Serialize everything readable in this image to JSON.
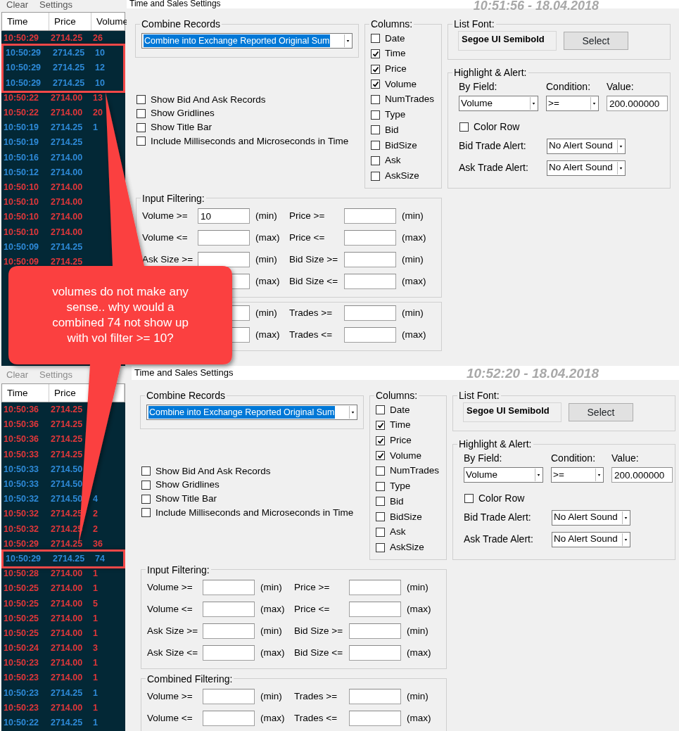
{
  "annotation": {
    "text": "volumes do not make any sense.. why would a combined 74 not show up with vol filter >= 10?"
  },
  "panels": [
    {
      "list": {
        "menu": [
          "Clear",
          "Settings"
        ],
        "columns": [
          "Time",
          "Price",
          "Volume"
        ],
        "rows": [
          {
            "time": "10:50:29",
            "price": "2714.25",
            "volume": "26",
            "color": "#e2373a",
            "boxed": false
          },
          {
            "time": "10:50:29",
            "price": "2714.25",
            "volume": "10",
            "color": "#2e8ad8",
            "boxed": true
          },
          {
            "time": "10:50:29",
            "price": "2714.25",
            "volume": "12",
            "color": "#2e8ad8",
            "boxed": true
          },
          {
            "time": "10:50:29",
            "price": "2714.25",
            "volume": "10",
            "color": "#2e8ad8",
            "boxed": true
          },
          {
            "time": "10:50:22",
            "price": "2714.00",
            "volume": "13",
            "color": "#e2373a",
            "boxed": false
          },
          {
            "time": "10:50:22",
            "price": "2714.00",
            "volume": "20",
            "color": "#e2373a",
            "boxed": false
          },
          {
            "time": "10:50:19",
            "price": "2714.25",
            "volume": "1",
            "color": "#2e8ad8",
            "boxed": false
          },
          {
            "time": "10:50:19",
            "price": "2714.25",
            "color": "#2e8ad8",
            "boxed": false
          },
          {
            "time": "10:50:16",
            "price": "2714.00",
            "color": "#2e8ad8",
            "boxed": false
          },
          {
            "time": "10:50:12",
            "price": "2714.00",
            "color": "#2e8ad8",
            "boxed": false
          },
          {
            "time": "10:50:10",
            "price": "2714.00",
            "color": "#e2373a",
            "boxed": false
          },
          {
            "time": "10:50:10",
            "price": "2714.00",
            "color": "#e2373a",
            "boxed": false
          },
          {
            "time": "10:50:10",
            "price": "2714.00",
            "color": "#e2373a",
            "boxed": false
          },
          {
            "time": "10:50:10",
            "price": "2714.00",
            "color": "#e2373a",
            "boxed": false
          },
          {
            "time": "10:50:09",
            "price": "2714.25",
            "color": "#2e8ad8",
            "boxed": false
          },
          {
            "time": "10:50:09",
            "price": "2714.25",
            "color": "#e2373a",
            "boxed": false
          }
        ]
      },
      "dialog": {
        "title": "Time and Sales Settings",
        "timestamp": "10:51:56 - 18.04.2018",
        "combine": {
          "legend": "Combine Records",
          "value": "Combine into Exchange Reported Original Sum"
        },
        "options": [
          {
            "label": "Show Bid And Ask Records",
            "checked": false
          },
          {
            "label": "Show Gridlines",
            "checked": false
          },
          {
            "label": "Show Title Bar",
            "checked": false
          },
          {
            "label": "Include Milliseconds and Microseconds in Time",
            "checked": false
          }
        ],
        "columns_group": {
          "legend": "Columns:",
          "items": [
            {
              "label": "Date",
              "checked": false
            },
            {
              "label": "Time",
              "checked": true
            },
            {
              "label": "Price",
              "checked": true
            },
            {
              "label": "Volume",
              "checked": true
            },
            {
              "label": "NumTrades",
              "checked": false
            },
            {
              "label": "Type",
              "checked": false
            },
            {
              "label": "Bid",
              "checked": false
            },
            {
              "label": "BidSize",
              "checked": false
            },
            {
              "label": "Ask",
              "checked": false
            },
            {
              "label": "AskSize",
              "checked": false
            }
          ]
        },
        "list_font": {
          "legend": "List Font:",
          "font": "Segoe UI Semibold",
          "button": "Select"
        },
        "highlight": {
          "legend": "Highlight & Alert:",
          "by_field_label": "By Field:",
          "condition_label": "Condition:",
          "value_label": "Value:",
          "by_field": "Volume",
          "condition": ">=",
          "value": "200.000000",
          "color_row": {
            "label": "Color Row",
            "checked": false
          },
          "alerts": [
            {
              "label": "Bid Trade Alert:",
              "value": "No Alert Sound"
            },
            {
              "label": "Ask Trade Alert:",
              "value": "No Alert Sound"
            }
          ]
        },
        "input_filtering": {
          "legend": "Input Filtering:",
          "rows": [
            [
              {
                "label": "Volume >=",
                "value": "10",
                "unit": "(min)"
              },
              {
                "label": "Price >=",
                "unit": "(min)"
              }
            ],
            [
              {
                "label": "Volume <=",
                "unit": "(max)"
              },
              {
                "label": "Price <=",
                "unit": "(max)"
              }
            ],
            [
              {
                "label": "Ask Size >=",
                "unit": "(min)"
              },
              {
                "label": "Bid Size >=",
                "unit": "(min)"
              }
            ],
            [
              {
                "unit": "(max)"
              },
              {
                "label": "Bid Size <=",
                "unit": "(max)"
              }
            ]
          ]
        },
        "combined_filtering": {
          "rows": [
            [
              {
                "unit": "(min)"
              },
              {
                "label": "Trades >=",
                "unit": "(min)"
              }
            ],
            [
              {
                "unit": "(max)"
              },
              {
                "label": "Trades <=",
                "unit": "(max)"
              }
            ]
          ]
        }
      }
    },
    {
      "list": {
        "menu": [
          "Clear",
          "Settings"
        ],
        "columns": [
          "Time",
          "Price"
        ],
        "rows": [
          {
            "time": "10:50:36",
            "price": "2714.25",
            "color": "#e2373a",
            "boxed": false
          },
          {
            "time": "10:50:36",
            "price": "2714.25",
            "color": "#e2373a",
            "boxed": false
          },
          {
            "time": "10:50:36",
            "price": "2714.25",
            "color": "#e2373a",
            "boxed": false
          },
          {
            "time": "10:50:33",
            "price": "2714.25",
            "color": "#e2373a",
            "boxed": false
          },
          {
            "time": "10:50:33",
            "price": "2714.50",
            "color": "#2e8ad8",
            "boxed": false
          },
          {
            "time": "10:50:33",
            "price": "2714.50",
            "color": "#2e8ad8",
            "boxed": false
          },
          {
            "time": "10:50:32",
            "price": "2714.50",
            "volume": "4",
            "color": "#2e8ad8",
            "boxed": false
          },
          {
            "time": "10:50:32",
            "price": "2714.25",
            "volume": "2",
            "color": "#e2373a",
            "boxed": false
          },
          {
            "time": "10:50:32",
            "price": "2714.25",
            "volume": "2",
            "color": "#e2373a",
            "boxed": false
          },
          {
            "time": "10:50:29",
            "price": "2714.25",
            "volume": "36",
            "color": "#e2373a",
            "boxed": false
          },
          {
            "time": "10:50:29",
            "price": "2714.25",
            "volume": "74",
            "color": "#2e8ad8",
            "boxed": true
          },
          {
            "time": "10:50:28",
            "price": "2714.00",
            "volume": "1",
            "color": "#e2373a",
            "boxed": false
          },
          {
            "time": "10:50:25",
            "price": "2714.00",
            "volume": "1",
            "color": "#e2373a",
            "boxed": false
          },
          {
            "time": "10:50:25",
            "price": "2714.00",
            "volume": "5",
            "color": "#e2373a",
            "boxed": false
          },
          {
            "time": "10:50:25",
            "price": "2714.00",
            "volume": "1",
            "color": "#e2373a",
            "boxed": false
          },
          {
            "time": "10:50:25",
            "price": "2714.00",
            "volume": "1",
            "color": "#e2373a",
            "boxed": false
          },
          {
            "time": "10:50:24",
            "price": "2714.00",
            "volume": "3",
            "color": "#e2373a",
            "boxed": false
          },
          {
            "time": "10:50:23",
            "price": "2714.00",
            "volume": "1",
            "color": "#e2373a",
            "boxed": false
          },
          {
            "time": "10:50:23",
            "price": "2714.00",
            "volume": "1",
            "color": "#e2373a",
            "boxed": false
          },
          {
            "time": "10:50:23",
            "price": "2714.25",
            "volume": "1",
            "color": "#2e8ad8",
            "boxed": false
          },
          {
            "time": "10:50:23",
            "price": "2714.00",
            "volume": "1",
            "color": "#e2373a",
            "boxed": false
          },
          {
            "time": "10:50:22",
            "price": "2714.25",
            "volume": "1",
            "color": "#2e8ad8",
            "boxed": false
          }
        ]
      },
      "dialog": {
        "title": "Time and Sales Settings",
        "timestamp": "10:52:20 - 18.04.2018",
        "combine": {
          "legend": "Combine Records",
          "value": "Combine into Exchange Reported Original Sum"
        },
        "options": [
          {
            "label": "Show Bid And Ask Records",
            "checked": false
          },
          {
            "label": "Show Gridlines",
            "checked": false
          },
          {
            "label": "Show Title Bar",
            "checked": false
          },
          {
            "label": "Include Milliseconds and Microseconds in Time",
            "checked": false
          }
        ],
        "columns_group": {
          "legend": "Columns:",
          "items": [
            {
              "label": "Date",
              "checked": false
            },
            {
              "label": "Time",
              "checked": true
            },
            {
              "label": "Price",
              "checked": true
            },
            {
              "label": "Volume",
              "checked": true
            },
            {
              "label": "NumTrades",
              "checked": false
            },
            {
              "label": "Type",
              "checked": false
            },
            {
              "label": "Bid",
              "checked": false
            },
            {
              "label": "BidSize",
              "checked": false
            },
            {
              "label": "Ask",
              "checked": false
            },
            {
              "label": "AskSize",
              "checked": false
            }
          ]
        },
        "list_font": {
          "legend": "List Font:",
          "font": "Segoe UI Semibold",
          "button": "Select"
        },
        "highlight": {
          "legend": "Highlight & Alert:",
          "by_field_label": "By Field:",
          "condition_label": "Condition:",
          "value_label": "Value:",
          "by_field": "Volume",
          "condition": ">=",
          "value": "200.000000",
          "color_row": {
            "label": "Color Row",
            "checked": false
          },
          "alerts": [
            {
              "label": "Bid Trade Alert:",
              "value": "No Alert Sound"
            },
            {
              "label": "Ask Trade Alert:",
              "value": "No Alert Sound"
            }
          ]
        },
        "input_filtering": {
          "legend": "Input Filtering:",
          "rows": [
            [
              {
                "label": "Volume >=",
                "unit": "(min)"
              },
              {
                "label": "Price >=",
                "unit": "(min)"
              }
            ],
            [
              {
                "label": "Volume <=",
                "unit": "(max)"
              },
              {
                "label": "Price <=",
                "unit": "(max)"
              }
            ],
            [
              {
                "label": "Ask Size >=",
                "unit": "(min)"
              },
              {
                "label": "Bid Size >=",
                "unit": "(min)"
              }
            ],
            [
              {
                "label": "Ask Size <=",
                "unit": "(max)"
              },
              {
                "label": "Bid Size <=",
                "unit": "(max)"
              }
            ]
          ]
        },
        "combined_filtering": {
          "legend": "Combined Filtering:",
          "rows": [
            [
              {
                "label": "Volume >=",
                "unit": "(min)"
              },
              {
                "label": "Trades >=",
                "unit": "(min)"
              }
            ],
            [
              {
                "label": "Volume <=",
                "unit": "(max)"
              },
              {
                "label": "Trades <=",
                "unit": "(max)"
              }
            ]
          ]
        }
      }
    }
  ]
}
